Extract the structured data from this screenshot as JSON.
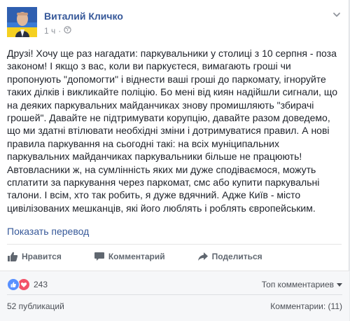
{
  "post": {
    "author": "Виталий Кличко",
    "time": "1 ч",
    "text": "Друзі! Хочу ще раз нагадати: паркувальники у столиці з 10 серпня - поза законом! І якщо з вас, коли ви паркуєтеся, вимагають гроші чи пропонують \"допомогти\" і віднести ваші гроші до паркомату, ігноруйте таких ділків і викликайте поліцію. Бо мені від киян надійшли сигнали, що на деяких паркувальних майданчиках знову промишляють \"збирачі грошей\". Давайте не підтримувати корупцію, давайте разом доведемо, що ми здатні втілювати необхідні зміни і дотримуватися правил. А нові правила паркування на сьогодні такі: на всіх муніципальних паркувальних майданчиках паркувальники більше не працюють! Автовласники ж, на сумлінність яких ми дуже сподіваємося, можуть сплатити за паркування через паркомат, смс або купити паркувальні талони. І всім, хто так робить, я дуже вдячний. Адже Київ - місто цивілізованих мешканців, які його люблять і роблять європейським.",
    "translate_label": "Показать перевод"
  },
  "actions": {
    "like": "Нравится",
    "comment": "Комментарий",
    "share": "Поделиться"
  },
  "reactions": {
    "count": "243",
    "sort_label": "Топ комментариев"
  },
  "footer": {
    "shares": "52 публикаций",
    "comments": "Комментарии: (11)"
  },
  "colors": {
    "link": "#365899",
    "like": "#5890ff",
    "love": "#f25268"
  }
}
